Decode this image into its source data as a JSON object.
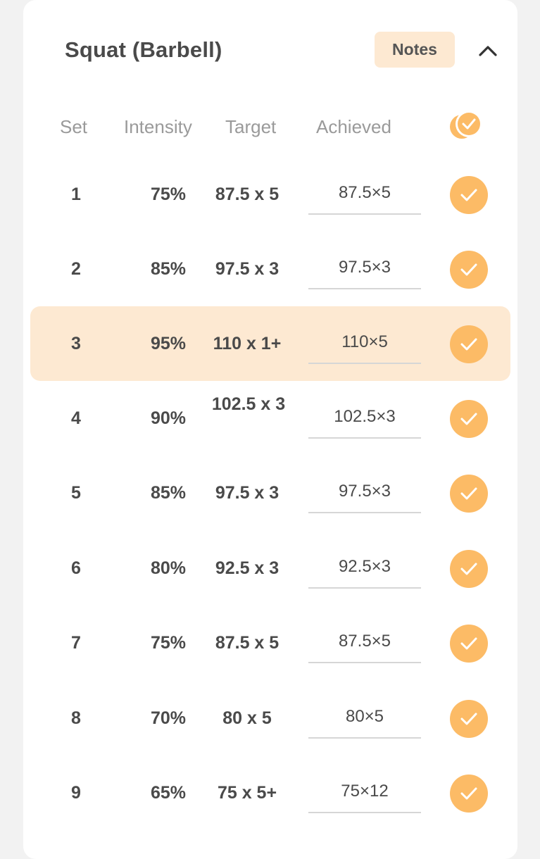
{
  "exercise": {
    "title": "Squat (Barbell)",
    "notes_label": "Notes",
    "collapse_icon": "chevron-up-icon"
  },
  "columns": {
    "set": "Set",
    "intensity": "Intensity",
    "target": "Target",
    "achieved": "Achieved",
    "complete_all_icon": "check-all-icon"
  },
  "rows": [
    {
      "set": "1",
      "intensity": "75%",
      "target": "87.5 x 5",
      "achieved": "87.5×5",
      "completed": true,
      "highlighted": false
    },
    {
      "set": "2",
      "intensity": "85%",
      "target": "97.5 x 3",
      "achieved": "97.5×3",
      "completed": true,
      "highlighted": false
    },
    {
      "set": "3",
      "intensity": "95%",
      "target": "110 x 1+",
      "achieved": "110×5",
      "completed": true,
      "highlighted": true
    },
    {
      "set": "4",
      "intensity": "90%",
      "target": "102.5 x 3",
      "achieved": "102.5×3",
      "completed": true,
      "highlighted": false
    },
    {
      "set": "5",
      "intensity": "85%",
      "target": "97.5 x 3",
      "achieved": "97.5×3",
      "completed": true,
      "highlighted": false
    },
    {
      "set": "6",
      "intensity": "80%",
      "target": "92.5 x 3",
      "achieved": "92.5×3",
      "completed": true,
      "highlighted": false
    },
    {
      "set": "7",
      "intensity": "75%",
      "target": "87.5 x 5",
      "achieved": "87.5×5",
      "completed": true,
      "highlighted": false
    },
    {
      "set": "8",
      "intensity": "70%",
      "target": "80 x 5",
      "achieved": "80×5",
      "completed": true,
      "highlighted": false
    },
    {
      "set": "9",
      "intensity": "65%",
      "target": "75 x 5+",
      "achieved": "75×12",
      "completed": true,
      "highlighted": false
    }
  ],
  "colors": {
    "accent": "#fcbb66",
    "highlight": "#fde9d2",
    "text": "#4a4a4a",
    "muted": "#9a9a9a"
  }
}
